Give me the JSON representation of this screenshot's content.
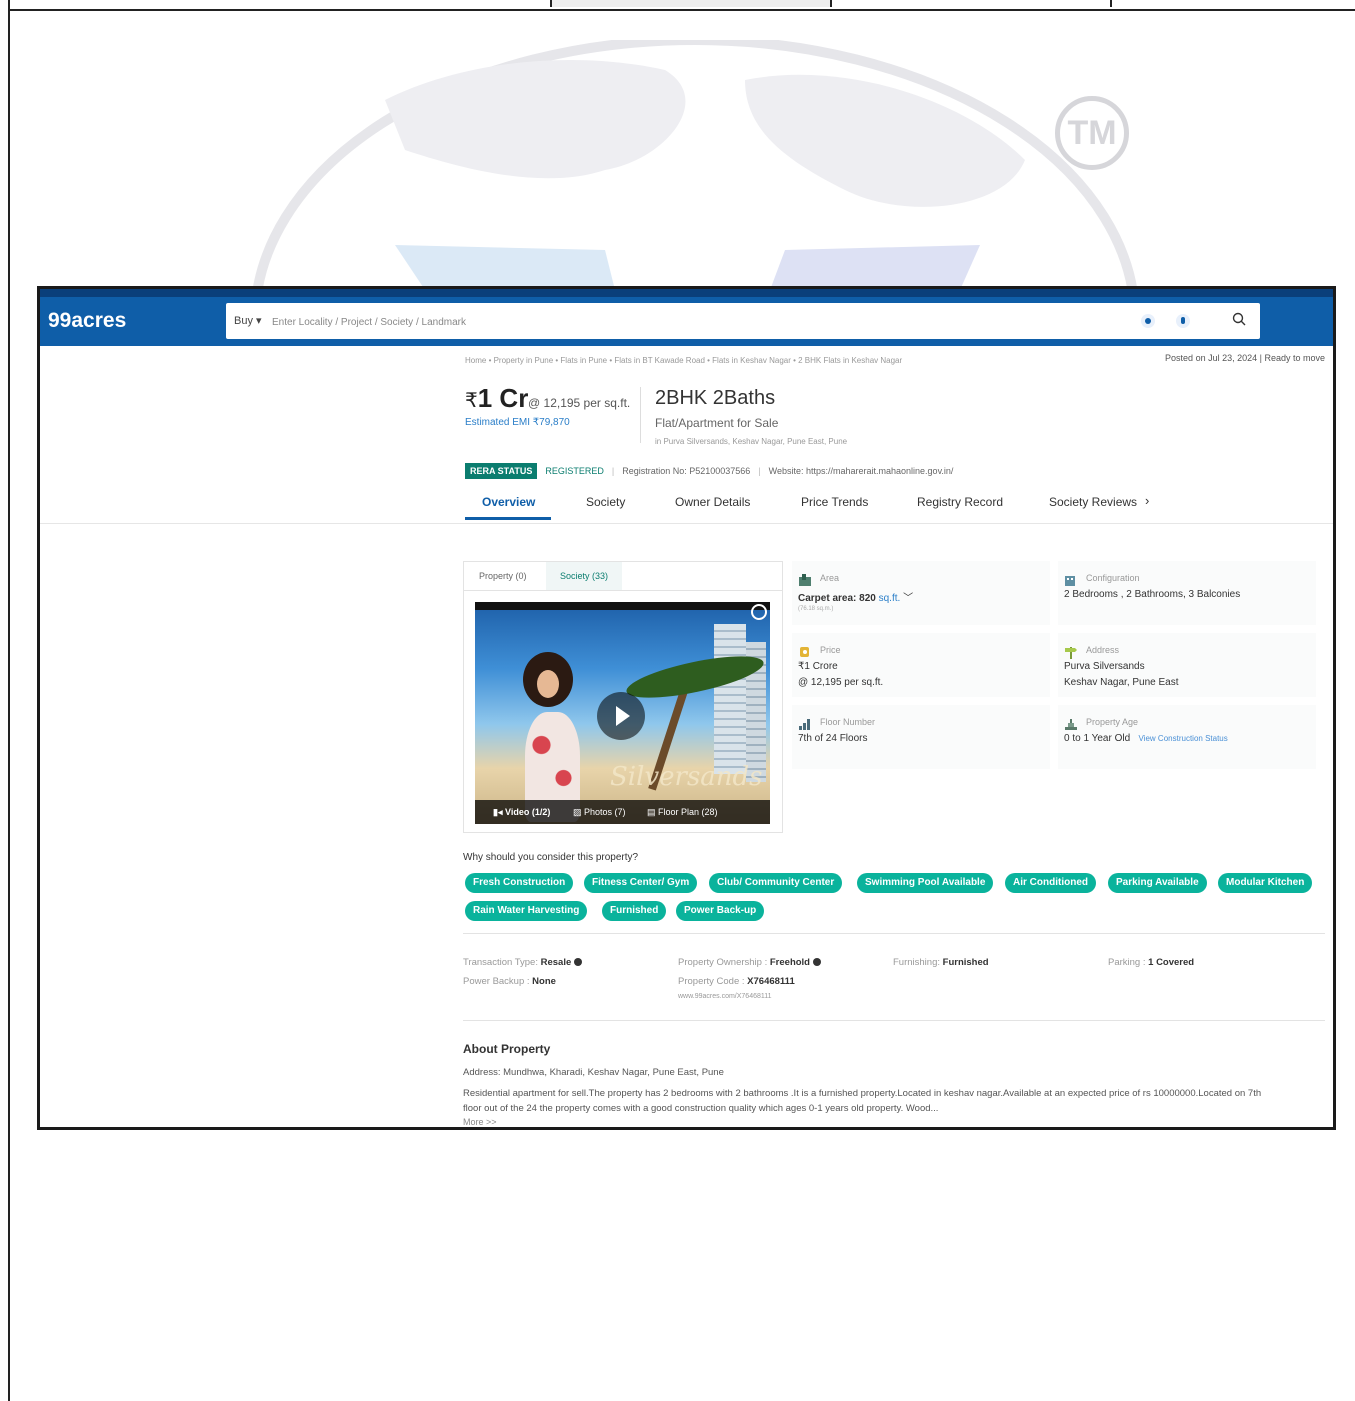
{
  "header": {
    "logo": "99acres",
    "buy_label": "Buy ▾",
    "search_placeholder": "Enter Locality / Project / Society / Landmark"
  },
  "listing": {
    "breadcrumb": "Home • Property in Pune • Flats in Pune • Flats in BT Kawade Road • Flats in Keshav Nagar • 2 BHK Flats in Keshav Nagar",
    "posted": "Posted on Jul 23, 2024  |  Ready to move",
    "price_symbol": "₹",
    "price_value": "1 Cr",
    "price_rate": "@ 12,195 per sq.ft.",
    "emi": "Estimated EMI ₹79,870",
    "title": "2BHK 2Baths",
    "subtitle": "Flat/Apartment for Sale",
    "location": "in Purva Silversands, Keshav Nagar, Pune East, Pune",
    "rera_status": "RERA STATUS",
    "rera_registered": "REGISTERED",
    "registration": "Registration No: P52100037566",
    "website": "Website: https://maharerait.mahaonline.gov.in/"
  },
  "tabs": [
    "Overview",
    "Society",
    "Owner Details",
    "Price Trends",
    "Registry Record",
    "Society Reviews"
  ],
  "media": {
    "tab_property": "Property (0)",
    "tab_society": "Society (33)",
    "brand_text": "Silversands",
    "bar_video": "Video (1/2)",
    "bar_photos": "Photos (7)",
    "bar_floorplan": "Floor Plan (28)"
  },
  "details": {
    "area_label": "Area",
    "area_value": "Carpet area: 820",
    "area_unit": "sq.ft.",
    "area_sub": "(76.18 sq.m.)",
    "config_label": "Configuration",
    "config_value": "2 Bedrooms , 2 Bathrooms, 3 Balconies",
    "price_label": "Price",
    "price_value": "₹1 Crore",
    "price_rate": "@ 12,195 per sq.ft.",
    "address_label": "Address",
    "address_line1": "Purva Silversands",
    "address_line2": "Keshav Nagar, Pune East",
    "floor_label": "Floor Number",
    "floor_value": "7th  of 24 Floors",
    "age_label": "Property Age",
    "age_value": "0 to 1 Year Old",
    "age_link": "View Construction Status"
  },
  "why": {
    "title": "Why should you consider this property?",
    "chips": [
      "Fresh Construction",
      "Fitness Center/ Gym",
      "Club/ Community Center",
      "Swimming Pool Available",
      "Air Conditioned",
      "Parking Available",
      "Modular Kitchen",
      "Rain Water Harvesting",
      "Furnished",
      "Power Back-up"
    ]
  },
  "facts": {
    "transaction_label": "Transaction Type: ",
    "transaction_value": "Resale",
    "ownership_label": "Property Ownership : ",
    "ownership_value": "Freehold",
    "furnishing_label": "Furnishing: ",
    "furnishing_value": "Furnished",
    "parking_label": "Parking : ",
    "parking_value": "1 Covered",
    "backup_label": "Power Backup : ",
    "backup_value": "None",
    "code_label": "Property Code : ",
    "code_value": "X76468111",
    "code_url": "www.99acres.com/X76468111"
  },
  "about": {
    "title": "About Property",
    "address": "Address: Mundhwa, Kharadi, Keshav Nagar, Pune East, Pune",
    "description": "Residential apartment for sell.The property has 2 bedrooms with 2 bathrooms .It is a furnished property.Located in keshav nagar.Available at an expected price of rs 10000000.Located on 7th floor out of the 24 the property comes with a good construction quality which ages 0-1 years old property. Wood...",
    "more": "More >>"
  },
  "watermark": {
    "tm": "TM"
  }
}
